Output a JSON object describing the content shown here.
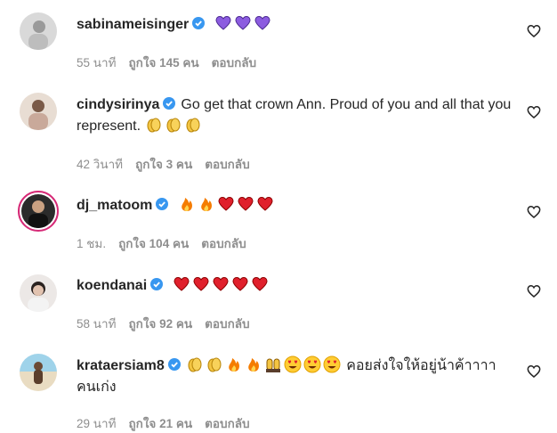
{
  "comments": [
    {
      "username": "sabinameisinger",
      "text": "",
      "emojis": [
        "purple-heart",
        "purple-heart",
        "purple-heart"
      ],
      "time": "55 นาที",
      "likes": "ถูกใจ 145 คน",
      "reply": "ตอบกลับ"
    },
    {
      "username": "cindysirinya",
      "text": "Go get that crown Ann. Proud of you and all that you represent.",
      "emojis": [
        "clap",
        "clap",
        "clap"
      ],
      "time": "42 วินาที",
      "likes": "ถูกใจ 3 คน",
      "reply": "ตอบกลับ"
    },
    {
      "username": "dj_matoom",
      "text": "",
      "emojis": [
        "fire",
        "fire",
        "red-heart",
        "red-heart",
        "red-heart"
      ],
      "time": "1 ชม.",
      "likes": "ถูกใจ 104 คน",
      "reply": "ตอบกลับ"
    },
    {
      "username": "koendanai",
      "text": "",
      "emojis": [
        "red-heart",
        "red-heart",
        "red-heart",
        "red-heart",
        "red-heart"
      ],
      "time": "58 นาที",
      "likes": "ถูกใจ 92 คน",
      "reply": "ตอบกลับ"
    },
    {
      "username": "krataersiam8",
      "text": "คอยส่งใจให้อยู่น้าค้าาาา คนเก่ง",
      "emojis": [
        "clap",
        "clap",
        "fire",
        "fire",
        "raised-hands",
        "heart-eyes",
        "heart-eyes",
        "heart-eyes"
      ],
      "time": "29 นาที",
      "likes": "ถูกใจ 21 คน",
      "reply": "ตอบกลับ"
    }
  ],
  "colors": {
    "verified": "#3897f0",
    "meta": "#8e8e8e",
    "story_ring": "#d62976"
  }
}
